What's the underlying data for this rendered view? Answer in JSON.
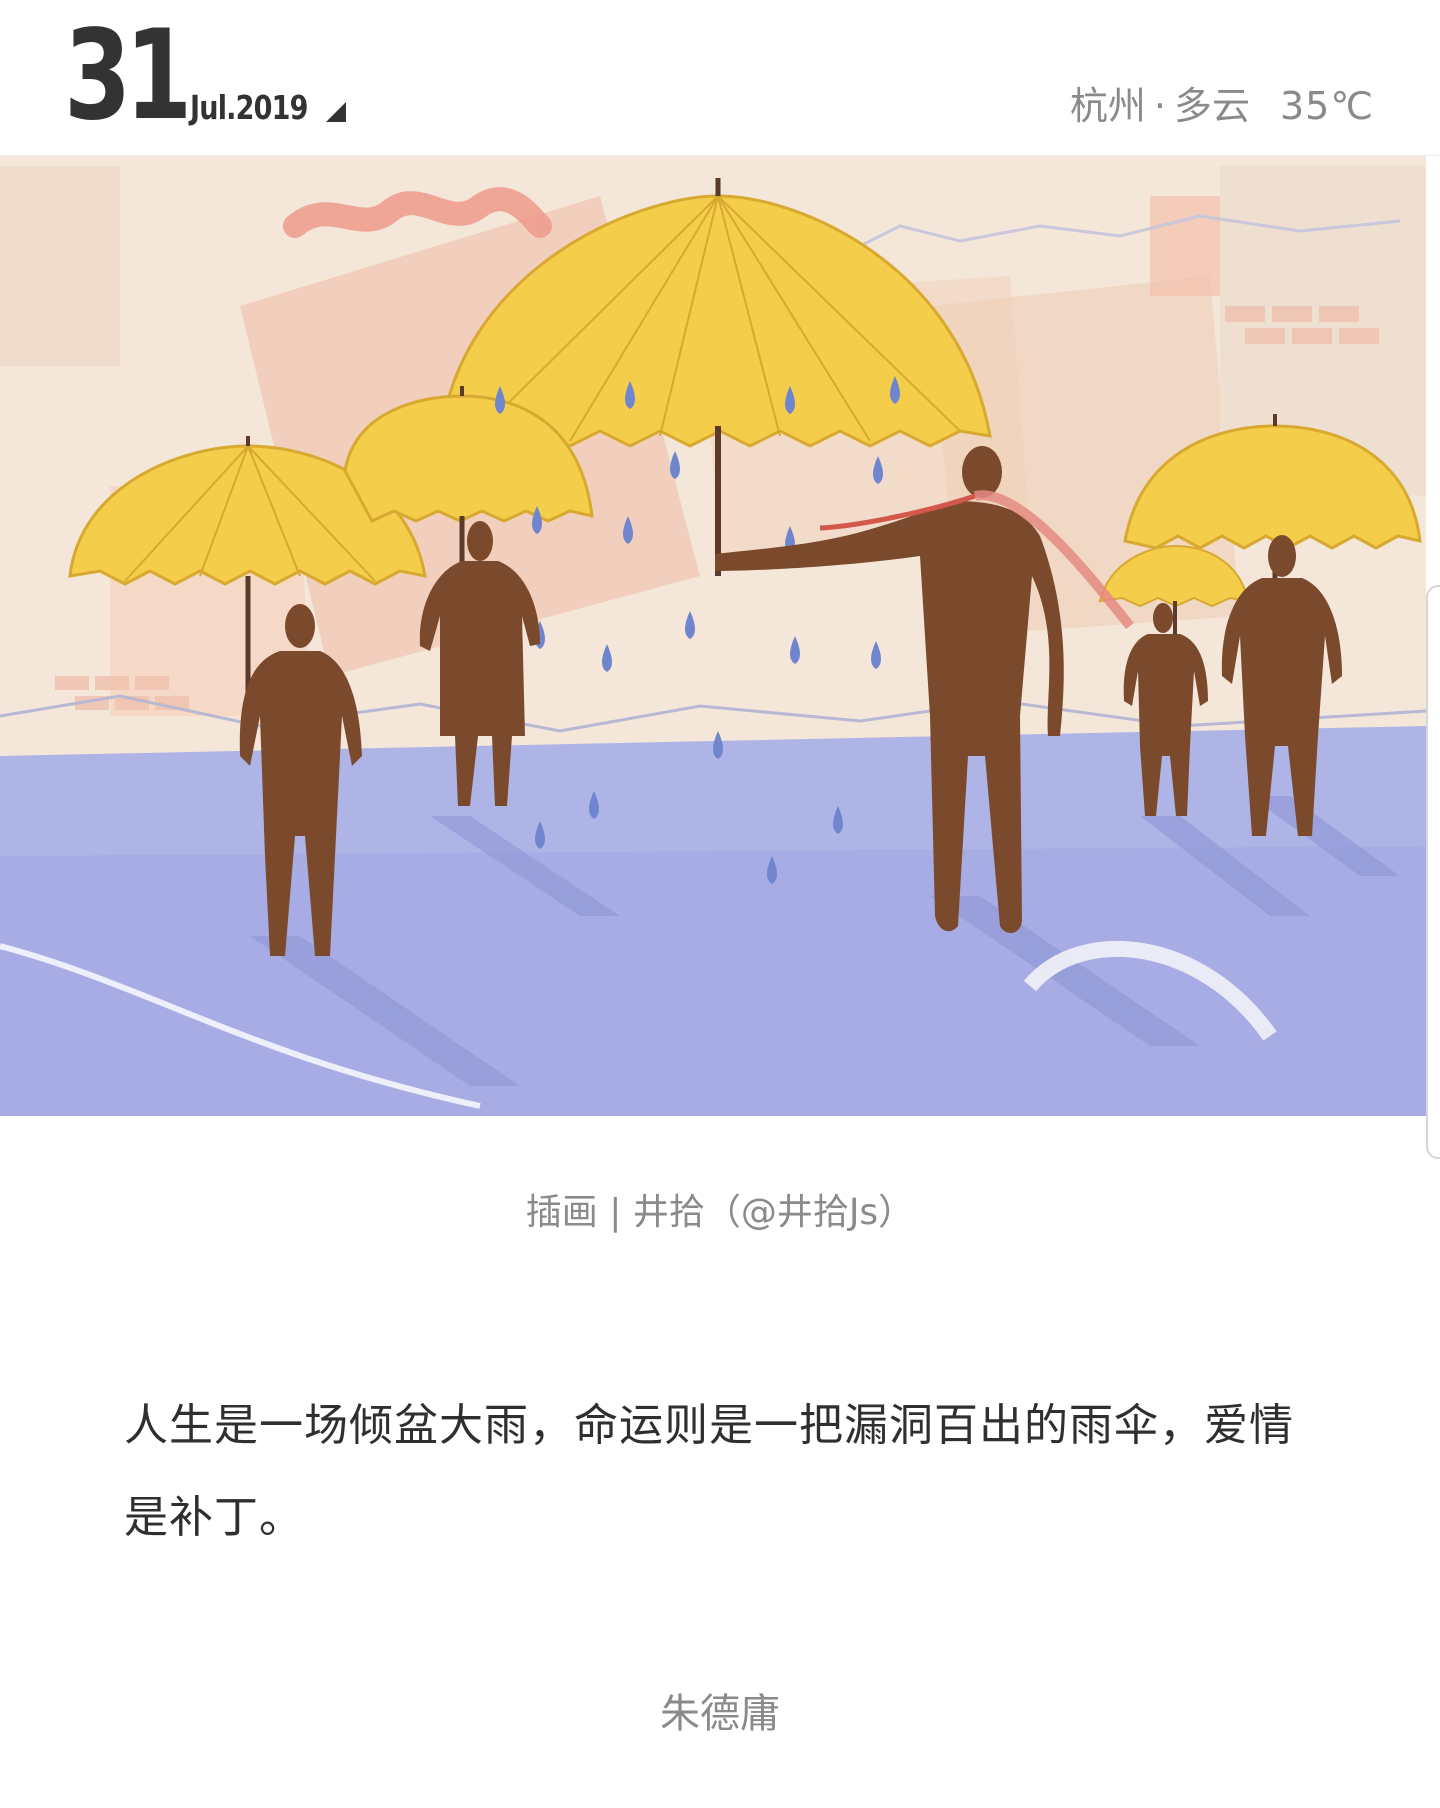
{
  "header": {
    "day": "31",
    "month_year": "Jul.2019",
    "caret_icon": "triangle-down-right-icon",
    "weather": {
      "city": "杭州",
      "separator": "·",
      "condition": "多云",
      "temperature": "35℃"
    }
  },
  "illustration": {
    "subject": "people-with-yellow-umbrellas-in-rain",
    "colors": {
      "umbrella": "#f4cd4a",
      "figure": "#7b4a2d",
      "raindrop": "#6f86cf",
      "ground": "#aeb4e6",
      "background": "#f4e6d8"
    }
  },
  "credit": "插画 | 井拾（@井拾Js）",
  "quote": "人生是一场倾盆大雨，命运则是一把漏洞百出的雨伞，爱情是补丁。",
  "author": "朱德庸"
}
